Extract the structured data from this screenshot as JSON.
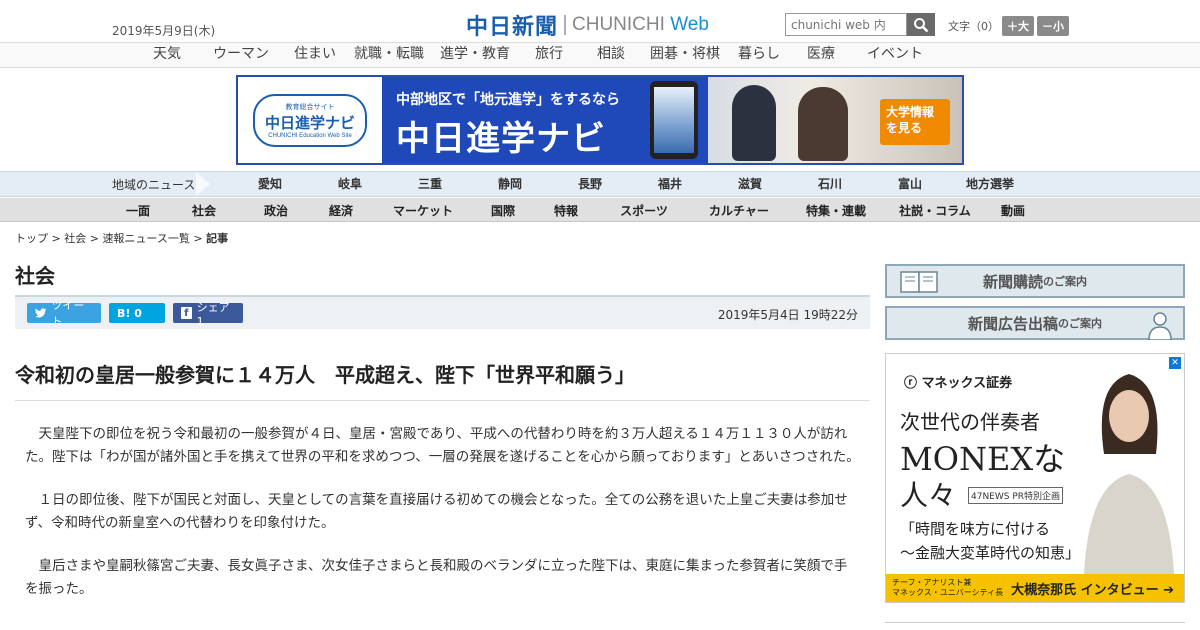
{
  "header": {
    "date": "2019年5月9日(木)",
    "logo_ja": "中日新聞",
    "logo_en_a": "CHUNICHI",
    "logo_en_b": "Web",
    "search_placeholder": "chunichi web 内",
    "fontsize_label": "文字（0）",
    "font_larger": "＋大",
    "font_smaller": "－小"
  },
  "topnav": [
    "天気",
    "ウーマン",
    "住まい",
    "就職・転職",
    "進学・教育",
    "旅行",
    "相談",
    "囲碁・将棋",
    "暮らし",
    "医療",
    "イベント"
  ],
  "banner": {
    "logo_small": "教育総合サイト",
    "logo_main": "中日進学ナビ",
    "logo_en": "CHUNICHI Education Web Site",
    "sub": "中部地区で「地元進学」をするなら",
    "main": "中日進学ナビ",
    "cta": "大学情報を見る"
  },
  "regions": {
    "label": "地域のニュース",
    "items": [
      "愛知",
      "岐阜",
      "三重",
      "静岡",
      "長野",
      "福井",
      "滋賀",
      "石川",
      "富山",
      "地方選挙"
    ]
  },
  "categories": [
    "一面",
    "社会",
    "政治",
    "経済",
    "マーケット",
    "国際",
    "特報",
    "スポーツ",
    "カルチャー",
    "特集・連載",
    "社説・コラム",
    "動画"
  ],
  "article": {
    "breadcrumb": [
      "トップ",
      "社会",
      "速報ニュース一覧",
      "記事"
    ],
    "breadcrumb_sep": " > ",
    "section": "社会",
    "tweet": "ツイート",
    "hatena": "B! 0",
    "share": "シェア 1",
    "pubdate": "2019年5月4日 19時22分",
    "headline": "令和初の皇居一般参賀に１４万人　平成超え、陛下「世界平和願う」",
    "paragraphs": [
      "天皇陛下の即位を祝う令和最初の一般参賀が４日、皇居・宮殿であり、平成への代替わり時を約３万人超える１４万１１３０人が訪れた。陛下は「わが国が諸外国と手を携えて世界の平和を求めつつ、一層の発展を遂げることを心から願っております」とあいさつされた。",
      "１日の即位後、陛下が国民と対面し、天皇としての言葉を直接届ける初めての機会となった。全ての公務を退いた上皇ご夫妻は参加せず、令和時代の新皇室への代替わりを印象付けた。",
      "皇后さまや皇嗣秋篠宮ご夫妻、長女眞子さま、次女佳子さまらと長和殿のベランダに立った陛下は、東庭に集まった参賀者に笑顔で手を振った。"
    ]
  },
  "sidebar": {
    "subscribe_main": "新聞購読",
    "subscribe_sub": "のご案内",
    "ads_main": "新聞広告出稿",
    "ads_sub": "のご案内"
  },
  "ad": {
    "brand": "マネックス証券",
    "line1": "次世代の伴奏者",
    "line2": "MONEXな",
    "line3": "人々",
    "pr": "47NEWS PR特別企画",
    "quote1": "「時間を味方に付ける",
    "quote2": "～金融大変革時代の知恵」",
    "foot_a1": "チーフ・アナリスト兼",
    "foot_a2": "マネックス・ユニバーシティ長",
    "foot_b": "大槻奈那氏 インタビュー ➔"
  }
}
